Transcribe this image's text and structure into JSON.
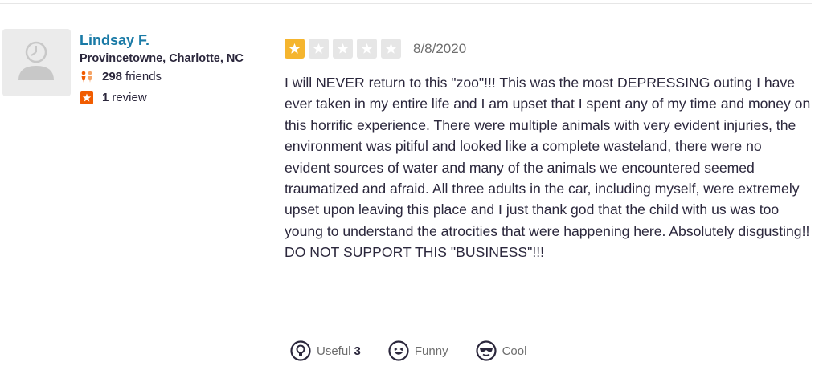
{
  "user": {
    "name": "Lindsay F.",
    "location": "Provincetowne, Charlotte, NC",
    "friends_count": "298",
    "friends_label": "friends",
    "reviews_count": "1",
    "reviews_label": "review",
    "avatar_icon": "default-avatar-icon"
  },
  "review": {
    "rating": 1,
    "max_rating": 5,
    "date": "8/8/2020",
    "text": "I will NEVER return to this \"zoo\"!!! This was the most DEPRESSING outing I have ever taken in my entire life and I am upset that I spent any of my time and money on this horrific experience. There were multiple animals with very evident injuries, the environment was pitiful and looked like a complete wasteland, there were no evident sources of water and many of the animals we encountered seemed traumatized and afraid. All three adults in the car, including myself, were extremely upset upon leaving this place and I just thank god that the child with us was too young to understand the atrocities that were happening here. Absolutely disgusting!! DO NOT SUPPORT THIS \"BUSINESS\"!!!"
  },
  "reactions": {
    "useful_label": "Useful",
    "useful_count": "3",
    "funny_label": "Funny",
    "cool_label": "Cool"
  },
  "colors": {
    "star_filled": "#f5b52e",
    "star_empty": "#e6e6e6",
    "user_name": "#1a7aa6",
    "friends_icon": "#f15c00",
    "review_icon": "#f15c00"
  }
}
